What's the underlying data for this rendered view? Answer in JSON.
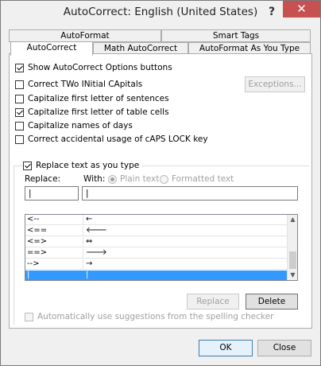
{
  "window": {
    "title": "AutoCorrect: English (United States)",
    "help_glyph": "?",
    "close_glyph": "✕"
  },
  "tabs": {
    "row1": [
      {
        "label": "AutoFormat"
      },
      {
        "label": "Smart Tags"
      }
    ],
    "row2": [
      {
        "label": "AutoCorrect",
        "active": true
      },
      {
        "label": "Math AutoCorrect"
      },
      {
        "label": "AutoFormat As You Type"
      }
    ]
  },
  "options": {
    "show_buttons": {
      "label": "Show AutoCorrect Options buttons",
      "checked": true
    },
    "two_initial_caps": {
      "label": "Correct TWo INitial CApitals",
      "checked": false
    },
    "first_letter_sentences": {
      "label": "Capitalize first letter of sentences",
      "checked": false
    },
    "first_letter_table_cells": {
      "label": "Capitalize first letter of table cells",
      "checked": true
    },
    "names_of_days": {
      "label": "Capitalize names of days",
      "checked": false
    },
    "caps_lock": {
      "label": "Correct accidental usage of cAPS LOCK key",
      "checked": false
    }
  },
  "exceptions_button": "Exceptions...",
  "replace_section": {
    "checkbox_label": "Replace text as you type",
    "checked": true,
    "replace_label": "Replace:",
    "with_label": "With:",
    "plain_text_label": "Plain text",
    "formatted_text_label": "Formatted text",
    "replace_value": "|",
    "with_value": "|"
  },
  "entries": [
    {
      "replace": "<--",
      "with": "←"
    },
    {
      "replace": "<==",
      "with": "🡐"
    },
    {
      "replace": "<=>",
      "with": "⇔"
    },
    {
      "replace": "==>",
      "with": "🡒"
    },
    {
      "replace": "-->",
      "with": "→"
    },
    {
      "replace": "|",
      "with": "|",
      "selected": true
    }
  ],
  "buttons": {
    "replace": "Replace",
    "delete": "Delete",
    "ok": "OK",
    "close": "Close"
  },
  "spelling_suggestions_label": "Automatically use suggestions from the spelling checker",
  "scroll_up_glyph": "▲",
  "scroll_down_glyph": "▼"
}
